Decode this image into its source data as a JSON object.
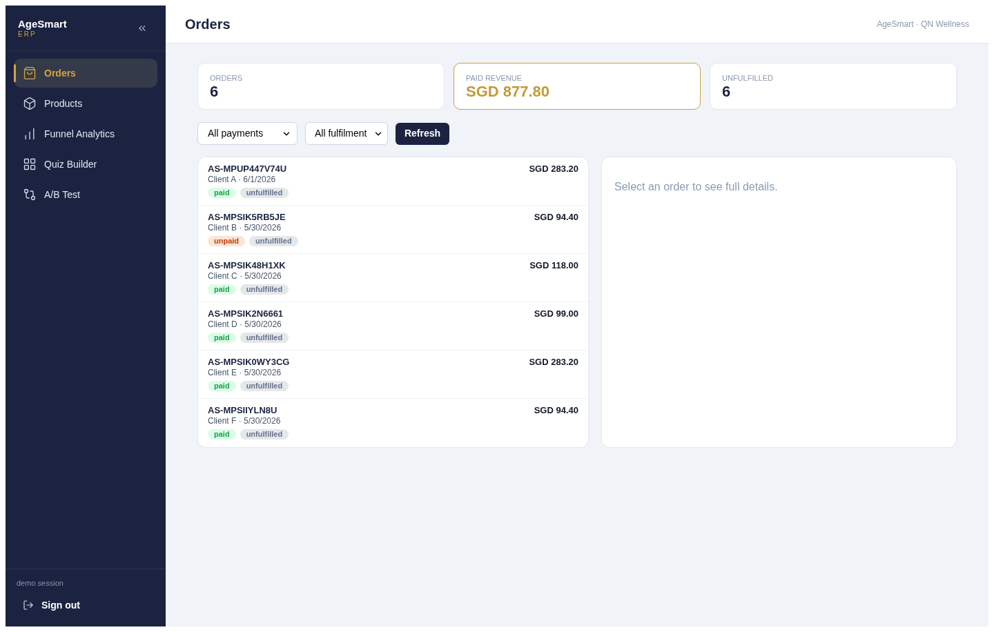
{
  "sidebar": {
    "brand": "AgeSmart",
    "brand_sub": "ERP",
    "items": [
      {
        "label": "Orders",
        "selected": true
      },
      {
        "label": "Products",
        "selected": false
      },
      {
        "label": "Funnel Analytics",
        "selected": false
      },
      {
        "label": "Quiz Builder",
        "selected": false
      },
      {
        "label": "A/B Test",
        "selected": false
      }
    ],
    "session": "demo session",
    "sign_out": "Sign out"
  },
  "header": {
    "title": "Orders",
    "org": "AgeSmart · QN Wellness"
  },
  "stats": [
    {
      "label": "ORDERS",
      "value": "6",
      "highlighted": false
    },
    {
      "label": "PAID REVENUE",
      "value": "SGD 877.80",
      "highlighted": true
    },
    {
      "label": "UNFULFILLED",
      "value": "6",
      "highlighted": false
    }
  ],
  "filters": {
    "payment": "All payments",
    "fulfilment": "All fulfilment",
    "refresh": "Refresh"
  },
  "orders": [
    {
      "id": "AS-MPUP447V74U",
      "meta": "Client A · 6/1/2026",
      "amount": "SGD 283.20",
      "payment": {
        "label": "paid",
        "kind": "paid"
      },
      "fulfilment": {
        "label": "unfulfilled",
        "kind": "unfulfilled"
      }
    },
    {
      "id": "AS-MPSIK5RB5JE",
      "meta": "Client B · 5/30/2026",
      "amount": "SGD 94.40",
      "payment": {
        "label": "unpaid",
        "kind": "unpaid"
      },
      "fulfilment": {
        "label": "unfulfilled",
        "kind": "unfulfilled"
      }
    },
    {
      "id": "AS-MPSIK48H1XK",
      "meta": "Client C · 5/30/2026",
      "amount": "SGD 118.00",
      "payment": {
        "label": "paid",
        "kind": "paid"
      },
      "fulfilment": {
        "label": "unfulfilled",
        "kind": "unfulfilled"
      }
    },
    {
      "id": "AS-MPSIK2N6661",
      "meta": "Client D · 5/30/2026",
      "amount": "SGD 99.00",
      "payment": {
        "label": "paid",
        "kind": "paid"
      },
      "fulfilment": {
        "label": "unfulfilled",
        "kind": "unfulfilled"
      }
    },
    {
      "id": "AS-MPSIK0WY3CG",
      "meta": "Client E · 5/30/2026",
      "amount": "SGD 283.20",
      "payment": {
        "label": "paid",
        "kind": "paid"
      },
      "fulfilment": {
        "label": "unfulfilled",
        "kind": "unfulfilled"
      }
    },
    {
      "id": "AS-MPSIIYLN8U",
      "meta": "Client F · 5/30/2026",
      "amount": "SGD 94.40",
      "payment": {
        "label": "paid",
        "kind": "paid"
      },
      "fulfilment": {
        "label": "unfulfilled",
        "kind": "unfulfilled"
      }
    }
  ],
  "detail": {
    "placeholder": "Select an order to see full details."
  }
}
